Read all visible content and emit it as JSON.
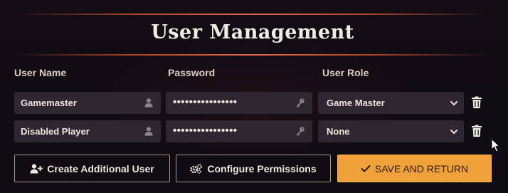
{
  "title": "User Management",
  "headers": {
    "user_name": "User Name",
    "password": "Password",
    "user_role": "User Role"
  },
  "users": [
    {
      "name": "Gamemaster",
      "password_mask": "••••••••••••••••",
      "role": "Game Master"
    },
    {
      "name": "Disabled Player",
      "password_mask": "••••••••••••••••",
      "role": "None"
    }
  ],
  "buttons": {
    "create_user": "Create Additional User",
    "configure_permissions": "Configure Permissions",
    "save_return": "SAVE AND RETURN"
  },
  "icons": {
    "user_field": "user-icon",
    "password_field": "key-icon",
    "role_select": "chevron-down-icon",
    "delete": "trash-icon",
    "create_user": "user-plus-icon",
    "permissions": "cogs-icon",
    "save": "check-icon",
    "cursor": "mouse-pointer-icon"
  },
  "colors": {
    "background": "#0f0c12",
    "field": "#2e2731",
    "accent_rule": "#e0684a",
    "primary_button": "#f0a13a",
    "outline_border": "#a8968a"
  }
}
